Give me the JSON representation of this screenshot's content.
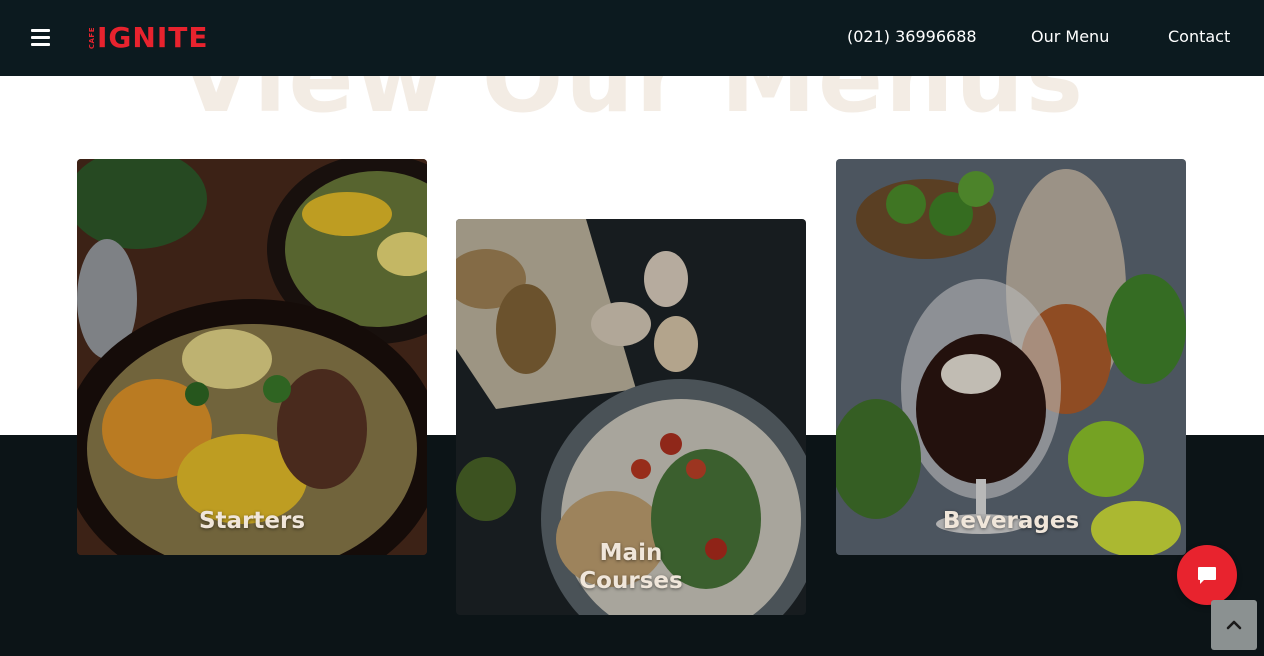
{
  "header": {
    "logo_small": "CAFE",
    "logo_main": "IGNITE",
    "phone": "(021) 36996688",
    "nav": {
      "our_menu": "Our Menu",
      "contact": "Contact"
    }
  },
  "section": {
    "heading": "View Our Menus"
  },
  "cards": [
    {
      "label": "Starters"
    },
    {
      "label": "Main Courses"
    },
    {
      "label": "Beverages"
    }
  ],
  "icons": {
    "menu": "hamburger-icon",
    "chat": "chat-bubble-icon",
    "scroll_top": "chevron-up-icon"
  },
  "colors": {
    "header_bg": "#0c1a1f",
    "brand_red": "#e8232e",
    "band_bg": "#0c1417",
    "label_text": "#f0e6da"
  }
}
